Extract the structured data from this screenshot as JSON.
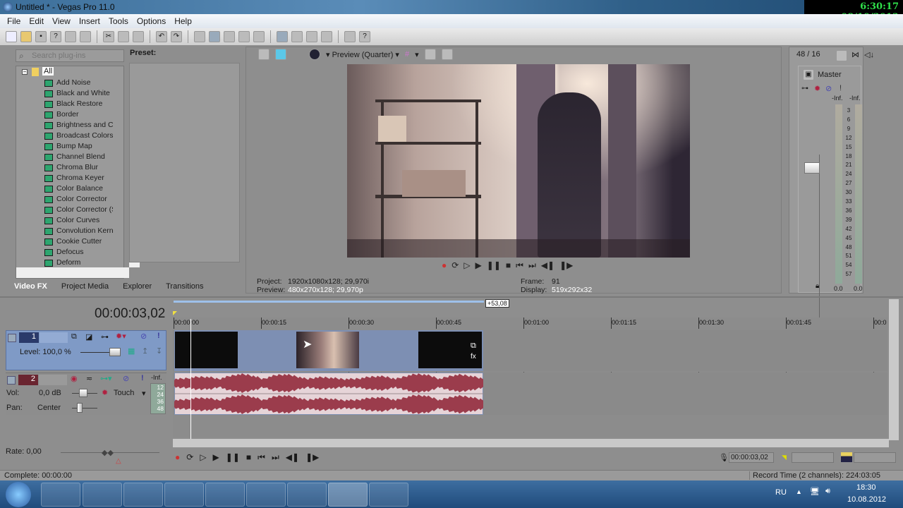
{
  "window": {
    "title": "Untitled * - Vegas Pro 11.0",
    "overlay_clock": "6:30:17  08/10/2012"
  },
  "menu": [
    "File",
    "Edit",
    "View",
    "Insert",
    "Tools",
    "Options",
    "Help"
  ],
  "plugins": {
    "search_placeholder": "Search plug-ins",
    "root": "All",
    "items": [
      "Add Noise",
      "Black and White",
      "Black Restore",
      "Border",
      "Brightness and Co",
      "Broadcast Colors",
      "Bump Map",
      "Channel Blend",
      "Chroma Blur",
      "Chroma Keyer",
      "Color Balance",
      "Color Corrector",
      "Color Corrector (S",
      "Color Curves",
      "Convolution Kerne",
      "Cookie Cutter",
      "Defocus",
      "Deform"
    ],
    "preset_label": "Preset:"
  },
  "dock_tabs": [
    "Video FX",
    "Project Media",
    "Explorer",
    "Transitions"
  ],
  "preview": {
    "quality": "Preview (Quarter)",
    "project_label": "Project:",
    "project_value": "1920x1080x128; 29,970i",
    "preview_label": "Preview:",
    "preview_value": "480x270x128; 29,970p",
    "frame_label": "Frame:",
    "frame_value": "91",
    "display_label": "Display:",
    "display_value": "519x292x32"
  },
  "mixer": {
    "ratio": "48 / 16",
    "master": "Master",
    "peak_left": "-Inf.",
    "peak_right": "-Inf.",
    "scale": [
      "3",
      "6",
      "9",
      "12",
      "15",
      "18",
      "21",
      "24",
      "27",
      "30",
      "33",
      "36",
      "39",
      "42",
      "45",
      "48",
      "51",
      "54",
      "57"
    ],
    "value_left": "0.0",
    "value_right": "0.0"
  },
  "timeline": {
    "timecode": "00:00:03,02",
    "loop_length": "+53,08",
    "ruler": [
      "00:00:00",
      "00:00:15",
      "00:00:30",
      "00:00:45",
      "00:01:00",
      "00:01:15",
      "00:01:30",
      "00:01:45",
      "00:0"
    ],
    "video_track": {
      "number": "1",
      "level": "Level: 100,0 %"
    },
    "audio_track": {
      "number": "2",
      "vol_label": "Vol:",
      "vol_value": "0,0 dB",
      "pan_label": "Pan:",
      "pan_value": "Center",
      "automation": "Touch",
      "meter_top": "-Inf.",
      "meter_scale": [
        "12",
        "24",
        "36",
        "48"
      ]
    },
    "rate": "Rate: 0,00",
    "cursor_time": "00:00:03,02"
  },
  "status": {
    "complete": "Complete: 00:00:00",
    "record_time": "Record Time (2 channels): 224:03:05"
  },
  "taskbar": {
    "lang": "RU",
    "time": "18:30",
    "date": "10.08.2012"
  },
  "colors": {
    "clip_waveform": "#9b3c4c",
    "track_selected": "#7f9ac6",
    "clock_text": "#2fe04a"
  }
}
